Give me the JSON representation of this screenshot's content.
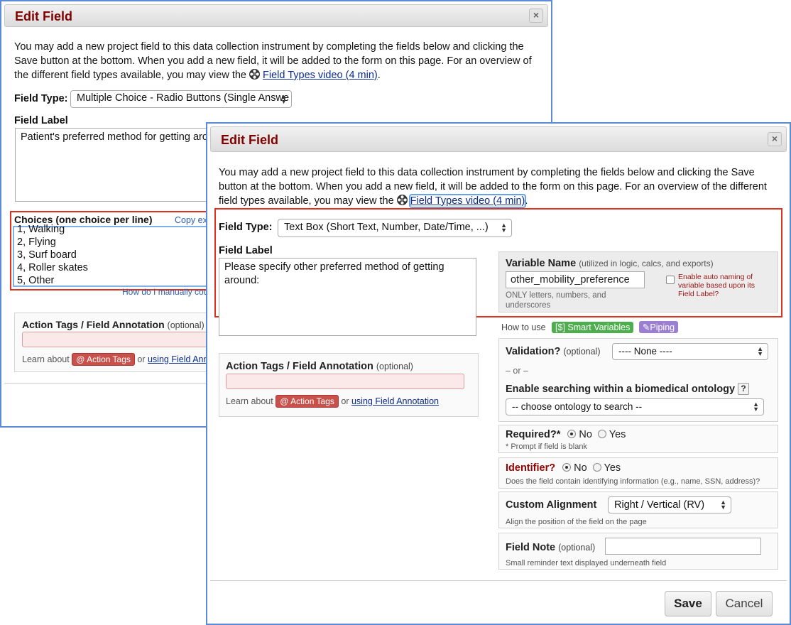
{
  "back_dialog": {
    "title": "Edit Field",
    "close": "×",
    "intro_text": "You may add a new project field to this data collection instrument by completing the fields below and clicking the Save button at the bottom. When you add a new field, it will be added to the form on this page. For an overview of the different field types available, you may view the",
    "video_link": "Field Types video (4 min)",
    "field_type_label": "Field Type:",
    "field_type_value": "Multiple Choice - Radio Buttons (Single Answe",
    "field_label_label": "Field Label",
    "field_label_value": "Patient's preferred method for getting aro",
    "choices_label": "Choices (one choice per line)",
    "copy_link": "Copy exi",
    "choices": [
      "1, Walking",
      "2, Flying",
      "3, Surf board",
      "4, Roller skates",
      "5, Other"
    ],
    "manual_link": "How do I manually cod",
    "action_tags_title": "Action Tags / Field Annotation",
    "optional": "(optional)",
    "learn_about": "Learn about",
    "action_tags_badge": "@ Action Tags",
    "or": "or",
    "using_annotation": "using Field Annot"
  },
  "front_dialog": {
    "title": "Edit Field",
    "close": "×",
    "intro_text": "You may add a new project field to this data collection instrument by completing the fields below and clicking the Save button at the bottom. When you add a new field, it will be added to the form on this page. For an overview of the different field types available, you may view the",
    "video_link": "Field Types video (4 min)",
    "field_type_label": "Field Type:",
    "field_type_value": "Text Box (Short Text, Number, Date/Time, ...)",
    "field_label_label": "Field Label",
    "field_label_value": "Please specify other preferred method of getting around:",
    "variable_name_label": "Variable Name",
    "variable_name_hint": "(utilized in logic, calcs, and exports)",
    "variable_name_value": "other_mobility_preference",
    "variable_name_note": "ONLY letters, numbers, and underscores",
    "auto_naming_text": "Enable auto naming of variable based upon its Field Label?",
    "how_to_use": "How to use",
    "smart_variables": "[$] Smart Variables",
    "piping": "Piping",
    "action_tags_title": "Action Tags / Field Annotation",
    "optional": "(optional)",
    "learn_about": "Learn about",
    "action_tags_badge": "@ Action Tags",
    "or": "or",
    "using_annotation": "using Field Annotation",
    "validation_label": "Validation?",
    "validation_optional": "(optional)",
    "validation_value": "---- None ----",
    "or_divider": "– or –",
    "ontology_label": "Enable searching within a biomedical ontology",
    "ontology_help": "?",
    "ontology_value": "-- choose ontology to search --",
    "required_label": "Required?*",
    "required_no": "No",
    "required_yes": "Yes",
    "required_note": "* Prompt if field is blank",
    "identifier_label": "Identifier?",
    "identifier_no": "No",
    "identifier_yes": "Yes",
    "identifier_note": "Does the field contain identifying information (e.g., name, SSN, address)?",
    "alignment_label": "Custom Alignment",
    "alignment_value": "Right / Vertical (RV)",
    "alignment_note": "Align the position of the field on the page",
    "field_note_label": "Field Note",
    "field_note_optional": "(optional)",
    "field_note_hint": "Small reminder text displayed underneath field",
    "save_button": "Save",
    "cancel_button": "Cancel"
  },
  "colors": {
    "title_red": "#800000",
    "highlight_red": "#e0301e",
    "highlight_blue": "#6aa2e6",
    "dialog_border": "#5b8ad6",
    "identifier_red": "#990000",
    "smart_var_green": "#4cae4c",
    "piping_purple": "#9b7fd1"
  }
}
